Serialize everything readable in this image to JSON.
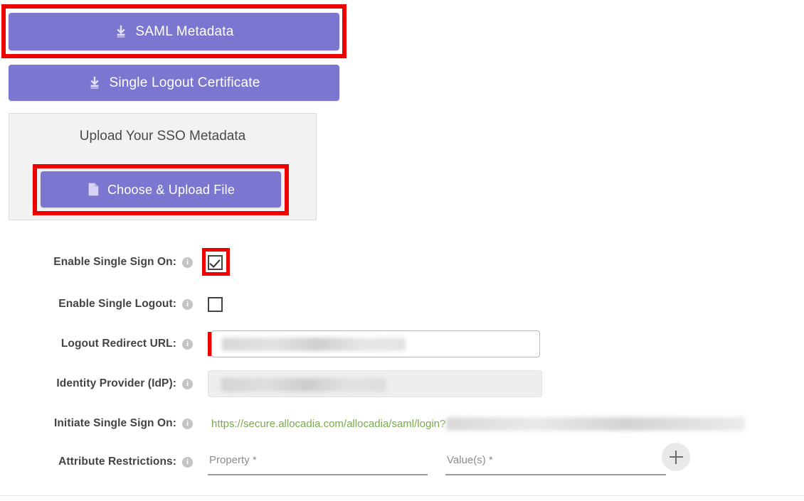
{
  "buttons": {
    "saml_metadata": {
      "label": "SAML Metadata",
      "icon": "download-icon"
    },
    "single_logout_certificate": {
      "label": "Single Logout Certificate",
      "icon": "download-icon"
    },
    "choose_upload_file": {
      "label": "Choose & Upload File",
      "icon": "file-document-icon"
    },
    "add_attribute": {
      "label": "+",
      "icon": "plus-icon"
    }
  },
  "upload_panel": {
    "title": "Upload Your SSO Metadata"
  },
  "form": {
    "rows": [
      {
        "label": "Enable Single Sign On:",
        "info": "i",
        "control": "checkbox",
        "checked": true
      },
      {
        "label": "Enable Single Logout:",
        "info": "i",
        "control": "checkbox",
        "checked": false
      },
      {
        "label": "Logout Redirect URL:",
        "info": "i",
        "control": "textbox",
        "required": true,
        "value": "",
        "disabled": false
      },
      {
        "label": "Identity Provider (IdP):",
        "info": "i",
        "control": "textbox",
        "required": false,
        "value": "",
        "disabled": true
      },
      {
        "label": "Initiate Single Sign On:",
        "info": "i",
        "control": "link",
        "value": "https://secure.allocadia.com/allocadia/saml/login?"
      },
      {
        "label": "Attribute Restrictions:",
        "info": "i",
        "control": "attribute-pair"
      }
    ],
    "attribute_inputs": {
      "property_placeholder": "Property *",
      "value_placeholder": "Value(s) *"
    }
  },
  "colors": {
    "button_purple": "#7b76d0",
    "annotation_red": "#ee0000",
    "link_green": "#7aa84f",
    "panel_gray": "#f2f2f2",
    "label_gray": "#444444"
  }
}
